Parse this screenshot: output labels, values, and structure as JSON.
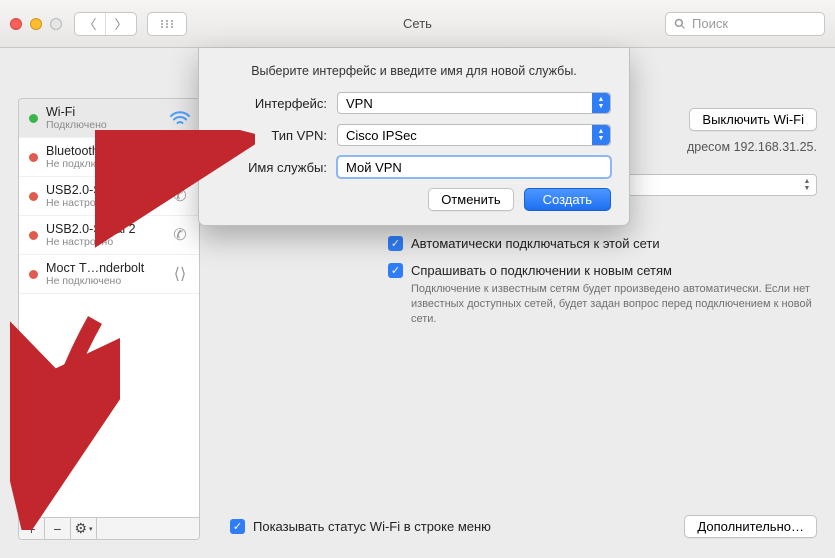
{
  "window": {
    "title": "Сеть"
  },
  "search": {
    "placeholder": "Поиск"
  },
  "sidebar": {
    "items": [
      {
        "name": "Wi-Fi",
        "sub": "Подключено",
        "status": "green",
        "icon": "wifi"
      },
      {
        "name": "Bluetooth PAN",
        "sub": "Не подключено",
        "status": "red",
        "icon": "bluetooth"
      },
      {
        "name": "USB2.0-Serial",
        "sub": "Не настроено",
        "status": "red",
        "icon": "phone"
      },
      {
        "name": "USB2.0-Serial 2",
        "sub": "Не настроено",
        "status": "red",
        "icon": "phone"
      },
      {
        "name": "Мост T…nderbolt",
        "sub": "Не подключено",
        "status": "red",
        "icon": "thunder"
      }
    ],
    "footer": {
      "add": "+",
      "remove": "−",
      "gear": "⚙︎"
    }
  },
  "content": {
    "wifi_off": "Выключить Wi-Fi",
    "ip_fragment": "дресом 192.168.31.25.",
    "auto_connect": "Автоматически подключаться к этой сети",
    "ask_networks": "Спрашивать о подключении к новым сетям",
    "ask_note": "Подключение к известным сетям будет произведено автоматически. Если нет известных доступных сетей, будет задан вопрос перед подключением к новой сети.",
    "status_bar": "Показывать статус Wi-Fi в строке меню",
    "more": "Дополнительно…"
  },
  "sheet": {
    "msg": "Выберите интерфейс и введите имя для новой службы.",
    "labels": {
      "interface": "Интерфейс:",
      "vpn_type": "Тип VPN:",
      "service_name": "Имя службы:"
    },
    "values": {
      "interface": "VPN",
      "vpn_type": "Cisco IPSec",
      "service_name": "Мой VPN"
    },
    "buttons": {
      "cancel": "Отменить",
      "create": "Создать"
    }
  }
}
